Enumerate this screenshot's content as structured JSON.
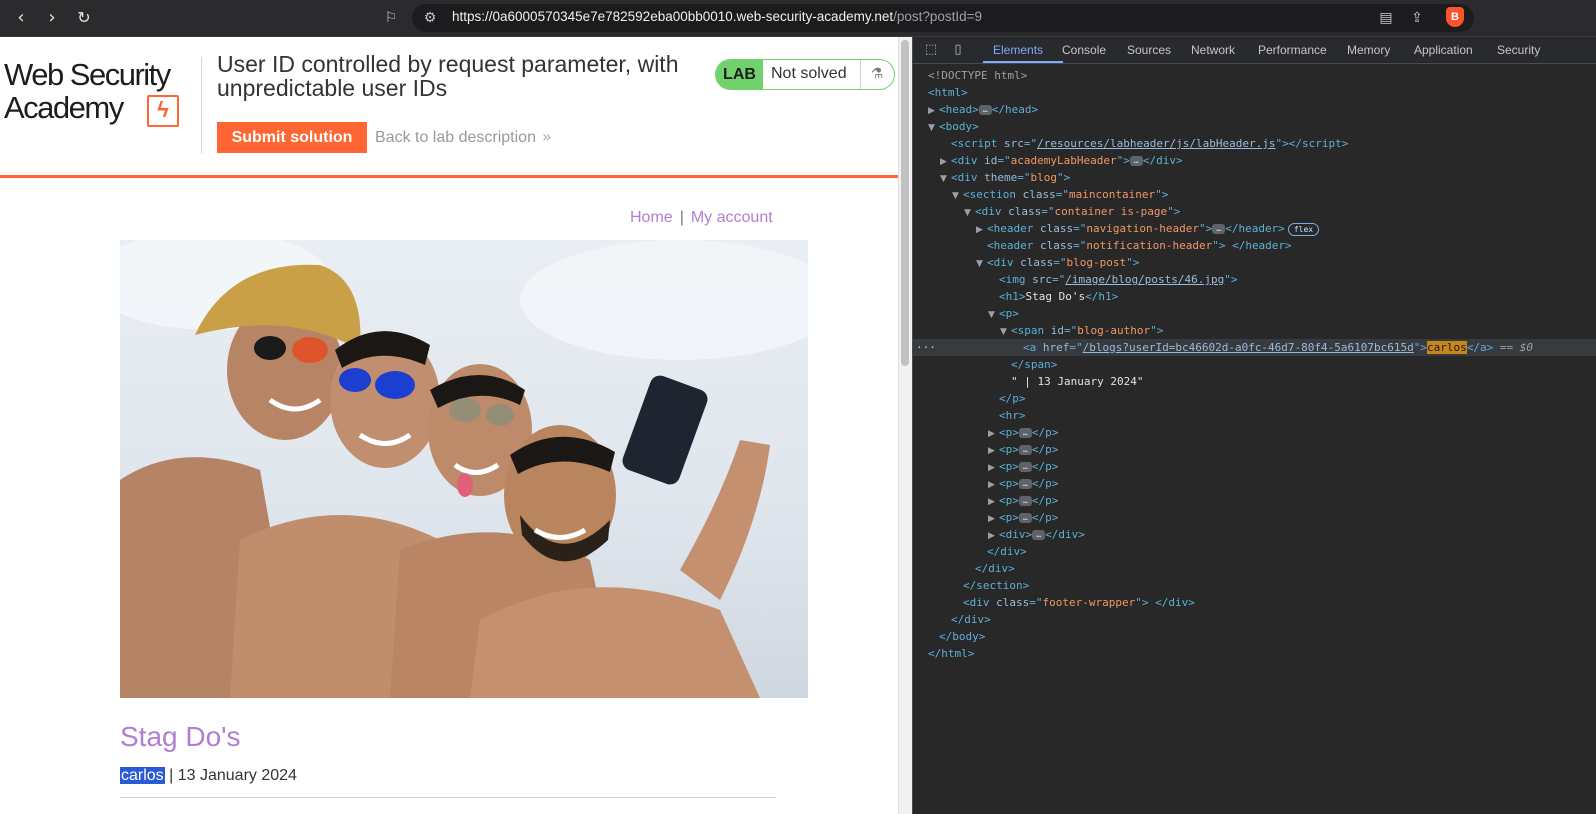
{
  "browser": {
    "url_host": "https://0a6000570345e7e782592eba00bb0010.web-security-academy.net",
    "url_path": "/post?postId=9",
    "icons": [
      "back-icon",
      "forward-icon",
      "reload-icon",
      "bookmark-icon",
      "site-info-icon",
      "reader-mode-icon",
      "share-icon",
      "brave-shield-icon"
    ]
  },
  "lab": {
    "logo_line1": "Web Security",
    "logo_line2": "Academy",
    "title": "User ID controlled by request parameter, with unpredictable user IDs",
    "submit_label": "Submit solution",
    "back_label": "Back to lab description",
    "status_badge": "LAB",
    "status_text": "Not solved",
    "accent_color": "#ff6633",
    "solved_color": "#70d16d"
  },
  "site_nav": {
    "home": "Home",
    "separator": "|",
    "account": "My account"
  },
  "post": {
    "title": "Stag Do's",
    "author": "carlos",
    "date_text": " | 13 January 2024",
    "image_alt": "four men taking a selfie on a beach"
  },
  "devtools": {
    "tabs": [
      "Elements",
      "Console",
      "Sources",
      "Network",
      "Performance",
      "Memory",
      "Application",
      "Security"
    ],
    "active_tab": "Elements",
    "lines": {
      "doctype": "<!DOCTYPE html>",
      "html_open": "<html>",
      "head": "head",
      "body": "body",
      "script_src": "/resources/labheader/js/labHeader.js",
      "lab_header_id": "academyLabHeader",
      "theme": "blog",
      "section_class": "maincontainer",
      "container_class": "container is-page",
      "nav_header_class": "navigation-header",
      "flex_badge": "flex",
      "notif_header_class": "notification-header",
      "blog_post_class": "blog-post",
      "img_src": "/image/blog/posts/46.jpg",
      "h1_text": "Stag Do's",
      "span_id": "blog-author",
      "author_href": "/blogs?userId=bc46602d-a0fc-46d7-80f4-5a6107bc615d",
      "author_text": "carlos",
      "eq_marker": "== $0",
      "date_text": "\" | 13 January 2024\"",
      "footer_class": "footer-wrapper"
    }
  }
}
